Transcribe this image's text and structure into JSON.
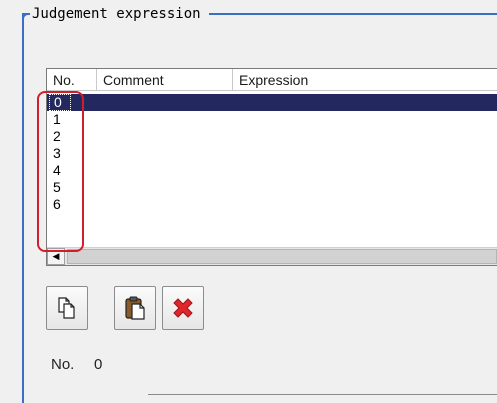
{
  "group": {
    "title": "Judgement expression"
  },
  "table": {
    "columns": [
      "No.",
      "Comment",
      "Expression"
    ],
    "rows": [
      {
        "no": "0",
        "comment": "",
        "expression": "",
        "selected": true
      },
      {
        "no": "1",
        "comment": "",
        "expression": ""
      },
      {
        "no": "2",
        "comment": "",
        "expression": ""
      },
      {
        "no": "3",
        "comment": "",
        "expression": ""
      },
      {
        "no": "4",
        "comment": "",
        "expression": ""
      },
      {
        "no": "5",
        "comment": "",
        "expression": ""
      },
      {
        "no": "6",
        "comment": "",
        "expression": ""
      }
    ]
  },
  "scrollbar": {
    "left_arrow": "◀"
  },
  "toolbar": {
    "copy_icon": "copy-icon",
    "paste_icon": "paste-icon",
    "delete_icon": "delete-icon"
  },
  "status": {
    "no_label": "No.",
    "no_value": "0"
  },
  "colors": {
    "group_border": "#3a6fc4",
    "selection": "#23285e",
    "highlight": "#d21e2b",
    "delete": "#e0262b"
  }
}
